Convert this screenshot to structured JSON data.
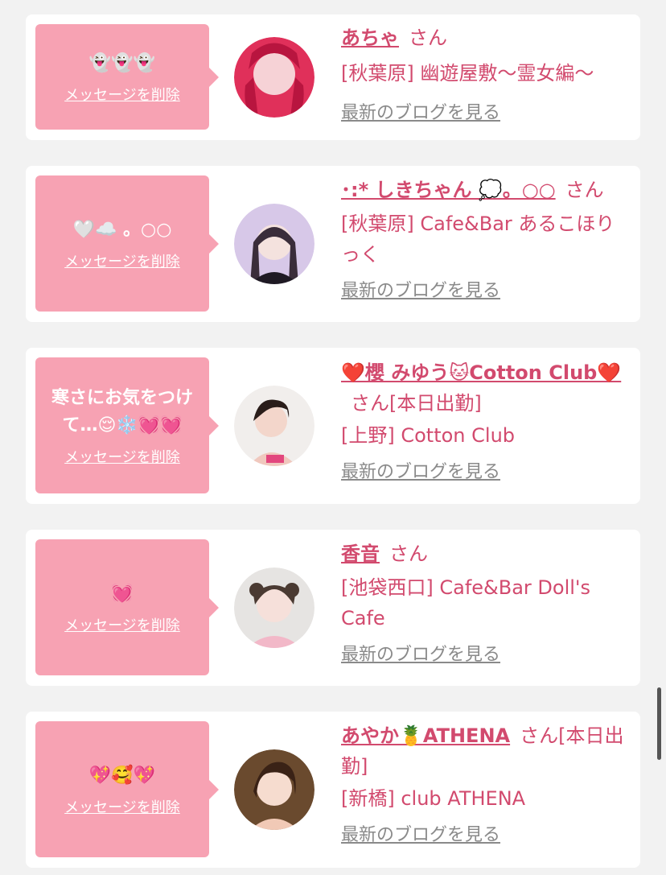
{
  "delete_label": "メッセージを削除",
  "blog_label": "最新のブログを見る",
  "cards": [
    {
      "message": "👻👻👻",
      "name": "あちゃ",
      "suffix": "さん",
      "shop": "[秋葉原] 幽遊屋敷〜霊女編〜"
    },
    {
      "message": "🤍☁️ 。○○",
      "name": "･:* しきちゃん 💭。○○",
      "suffix": "さん",
      "shop": "[秋葉原] Cafe&Bar あるこほりっく"
    },
    {
      "message": "寒さにお気をつけて…😌❄️💓💓",
      "name": "❤️櫻 みゆう🐱Cotton Club❤️",
      "suffix": "さん[本日出勤]",
      "shop": "[上野] Cotton Club"
    },
    {
      "message": "💓",
      "name": "香音",
      "suffix": "さん",
      "shop": "[池袋西口] Cafe&Bar Doll's Cafe"
    },
    {
      "message": "💖🥰💖",
      "name": "あやか🍍ATHENA",
      "suffix": "さん[本日出勤]",
      "shop": "[新橋] club ATHENA"
    }
  ],
  "colors": {
    "accent": "#d24a6e",
    "bubble": "#f7a2b3",
    "card": "#ffffff",
    "background": "#f2f2f2"
  }
}
